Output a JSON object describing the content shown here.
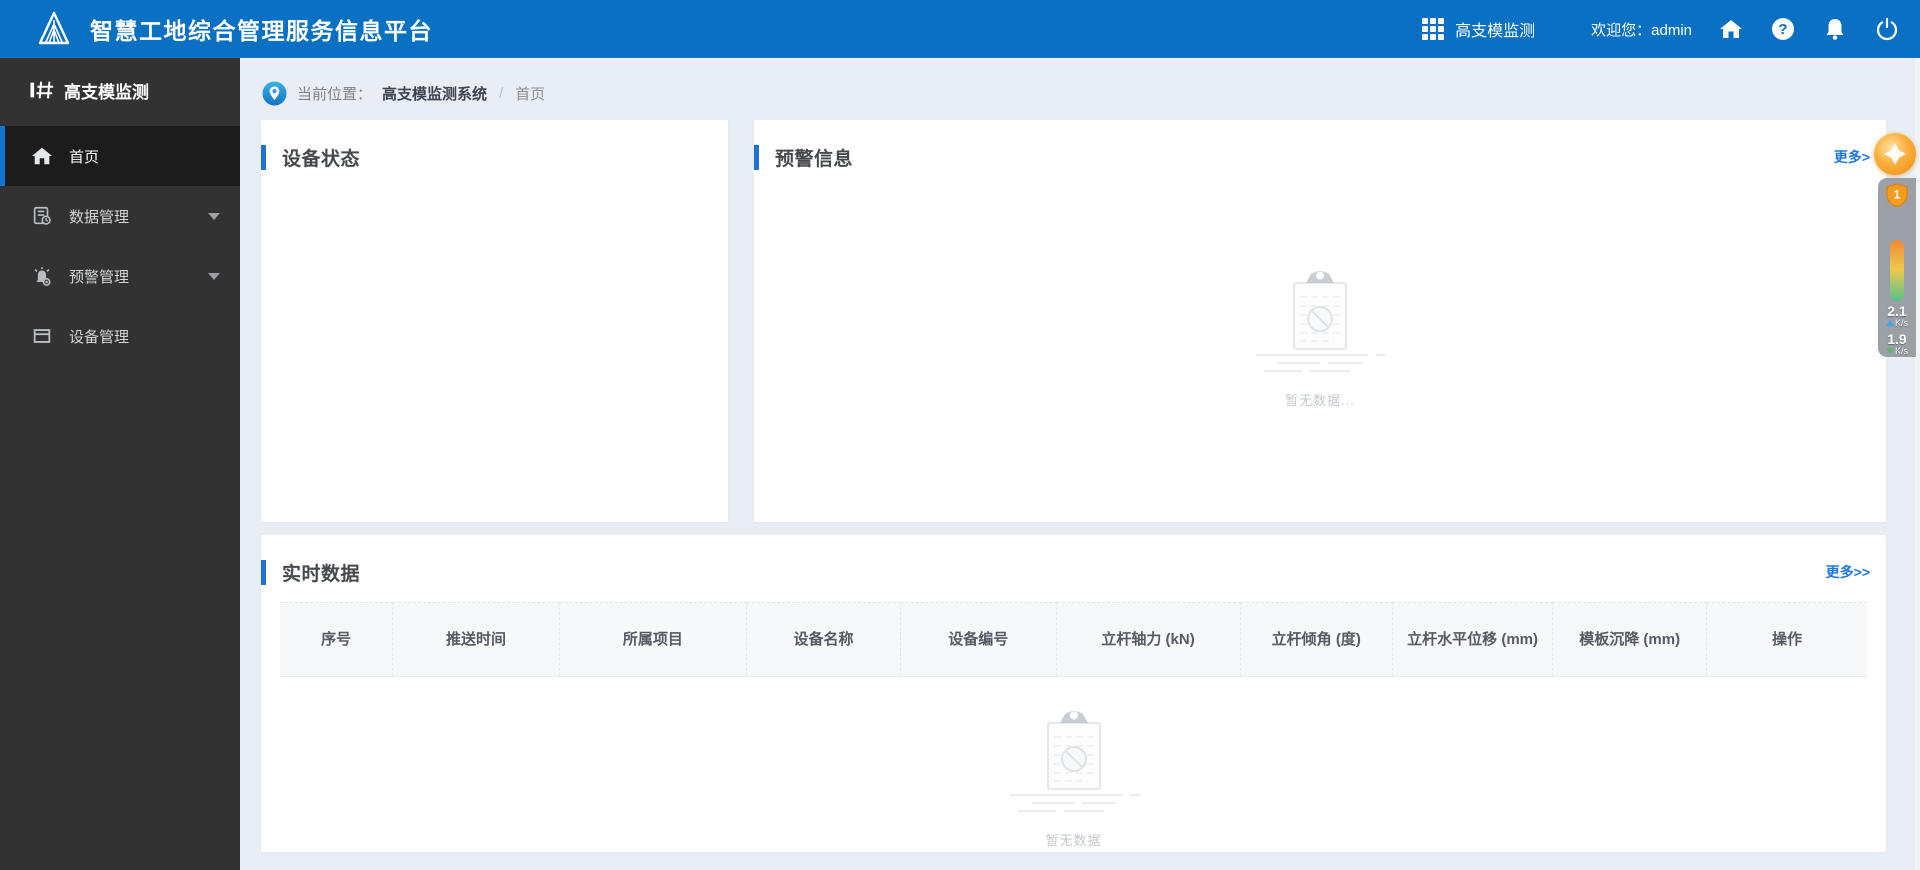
{
  "colors": {
    "header_blue": "#0a70c4",
    "accent_blue": "#2270d2",
    "link_blue": "#1f78dc",
    "sidebar_bg": "#323232",
    "sidebar_active_bg": "#1c1c1c",
    "content_bg": "#e9eef5"
  },
  "header": {
    "title": "智慧工地综合管理服务信息平台",
    "app_switcher_label": "高支模监测",
    "welcome_label": "欢迎您：",
    "username": "admin",
    "icons": [
      "apps-grid-icon",
      "home-icon",
      "help-icon",
      "bell-icon",
      "power-icon"
    ]
  },
  "sidebar": {
    "brand": "高支模监测",
    "items": [
      {
        "label": "首页",
        "icon": "home-icon",
        "active": true,
        "expandable": false
      },
      {
        "label": "数据管理",
        "icon": "data-management-icon",
        "active": false,
        "expandable": true
      },
      {
        "label": "预警管理",
        "icon": "alarm-management-icon",
        "active": false,
        "expandable": true
      },
      {
        "label": "设备管理",
        "icon": "device-management-icon",
        "active": false,
        "expandable": false
      }
    ]
  },
  "breadcrumb": {
    "prefix": "当前位置：",
    "root": "高支模监测系统",
    "separator": "/",
    "current": "首页"
  },
  "panels": {
    "device_status": {
      "title": "设备状态"
    },
    "warning_info": {
      "title": "预警信息",
      "more_label": "更多>",
      "empty_text": "暂无数据..."
    },
    "realtime_data": {
      "title": "实时数据",
      "more_label": "更多>>",
      "empty_text": "暂无数据",
      "table_headers": [
        "序号",
        "推送时间",
        "所属项目",
        "设备名称",
        "设备编号",
        "立杆轴力 (kN)",
        "立杆倾角 (度)",
        "立杆水平位移 (mm)",
        "模板沉降 (mm)",
        "操作"
      ],
      "column_widths_percent": [
        7.1,
        10.5,
        11.8,
        9.7,
        9.8,
        11.6,
        9.6,
        10.1,
        9.7,
        10.1
      ]
    }
  },
  "net_widget": {
    "badge": "1",
    "upload_speed": "2.1",
    "upload_unit": "K/s",
    "download_speed": "1.9",
    "download_unit": "K/s"
  }
}
